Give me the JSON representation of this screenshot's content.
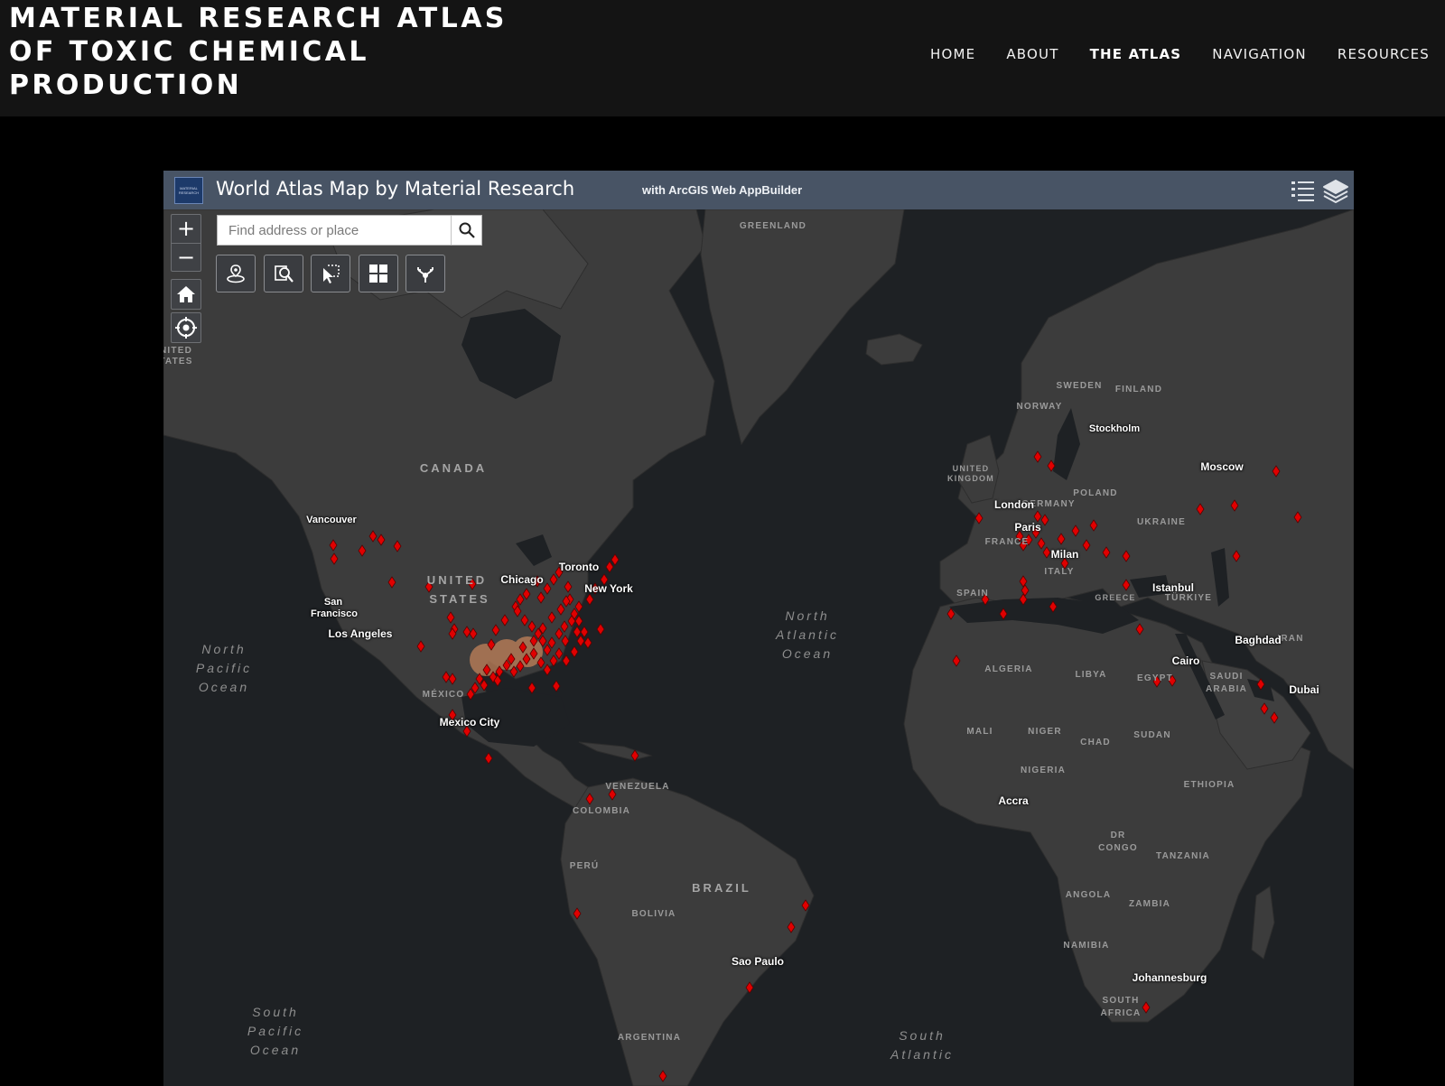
{
  "site": {
    "title_lines": [
      "MATERIAL RESEARCH ATLAS",
      "OF TOXIC CHEMICAL",
      "PRODUCTION"
    ],
    "nav": [
      {
        "label": "HOME",
        "active": false
      },
      {
        "label": "ABOUT",
        "active": false
      },
      {
        "label": "THE ATLAS",
        "active": true
      },
      {
        "label": "NAVIGATION",
        "active": false
      },
      {
        "label": "RESOURCES",
        "active": false
      }
    ]
  },
  "app": {
    "logo_text": "MATERIAL RESEARCH",
    "title": "World Atlas Map by Material Research",
    "subtitle": "with ArcGIS Web AppBuilder",
    "header_icons": [
      "legend-list-icon",
      "layers-icon"
    ]
  },
  "map": {
    "search": {
      "placeholder": "Find address or place"
    },
    "zoom_in": "+",
    "zoom_out": "−",
    "widgets": [
      "home-icon",
      "locate-icon"
    ],
    "tools": [
      "near-me-icon",
      "query-icon",
      "select-icon",
      "grid-icon",
      "share-icon"
    ],
    "colors": {
      "land": "#3c3c3c",
      "water": "#1e2124",
      "marker": "#e00000",
      "cluster": "#c2825a"
    },
    "labels": {
      "greenland": "GREENLAND",
      "canada": "CANADA",
      "united_states_l1": "UNITED",
      "united_states_l2": "STATES",
      "united_states_edge_l1": "NITED",
      "united_states_edge_l2": "TATES",
      "mexico": "MÉXICO",
      "venezuela": "VENEZUELA",
      "colombia": "COLOMBIA",
      "peru": "PERÚ",
      "brazil": "BRAZIL",
      "bolivia": "BOLIVIA",
      "argentina": "ARGENTINA",
      "sweden": "SWEDEN",
      "finland": "FINLAND",
      "norway": "NORWAY",
      "united_kingdom_l1": "UNITED",
      "united_kingdom_l2": "KINGDOM",
      "germany": "GERMANY",
      "poland": "POLAND",
      "ukraine": "UKRAINE",
      "france": "FRANCE",
      "italy": "ITALY",
      "spain": "SPAIN",
      "greece": "GREECE",
      "turkiye": "TÜRKIYE",
      "iran": "IRAN",
      "algeria": "ALGERIA",
      "libya": "LIBYA",
      "egypt": "EGYPT",
      "saudi_l1": "SAUDI",
      "saudi_l2": "ARABIA",
      "mali": "MALI",
      "niger": "NIGER",
      "chad": "CHAD",
      "sudan": "SUDAN",
      "nigeria": "NIGERIA",
      "ethiopia": "ETHIOPIA",
      "dr_l1": "DR",
      "dr_l2": "CONGO",
      "tanzania": "TANZANIA",
      "angola": "ANGOLA",
      "zambia": "ZAMBIA",
      "namibia": "NAMIBIA",
      "south_africa_l1": "SOUTH",
      "south_africa_l2": "AFRICA"
    },
    "cities": {
      "vancouver": "Vancouver",
      "san_francisco_l1": "San",
      "san_francisco_l2": "Francisco",
      "los_angeles": "Los Angeles",
      "chicago": "Chicago",
      "toronto": "Toronto",
      "new_york": "New York",
      "mexico_city": "Mexico City",
      "sao_paulo": "Sao Paulo",
      "stockholm": "Stockholm",
      "moscow": "Moscow",
      "london": "London",
      "paris": "Paris",
      "milan": "Milan",
      "istanbul": "Istanbul",
      "baghdad": "Baghdad",
      "cairo": "Cairo",
      "dubai": "Dubai",
      "accra": "Accra",
      "johannesburg": "Johannesburg"
    },
    "oceans": {
      "north_pacific": [
        "North",
        "Pacific",
        "Ocean"
      ],
      "north_atlantic": [
        "North",
        "Atlantic",
        "Ocean"
      ],
      "south_pacific": [
        "South",
        "Pacific",
        "Ocean"
      ],
      "south_atlantic": [
        "South",
        "Atlantic"
      ]
    }
  }
}
